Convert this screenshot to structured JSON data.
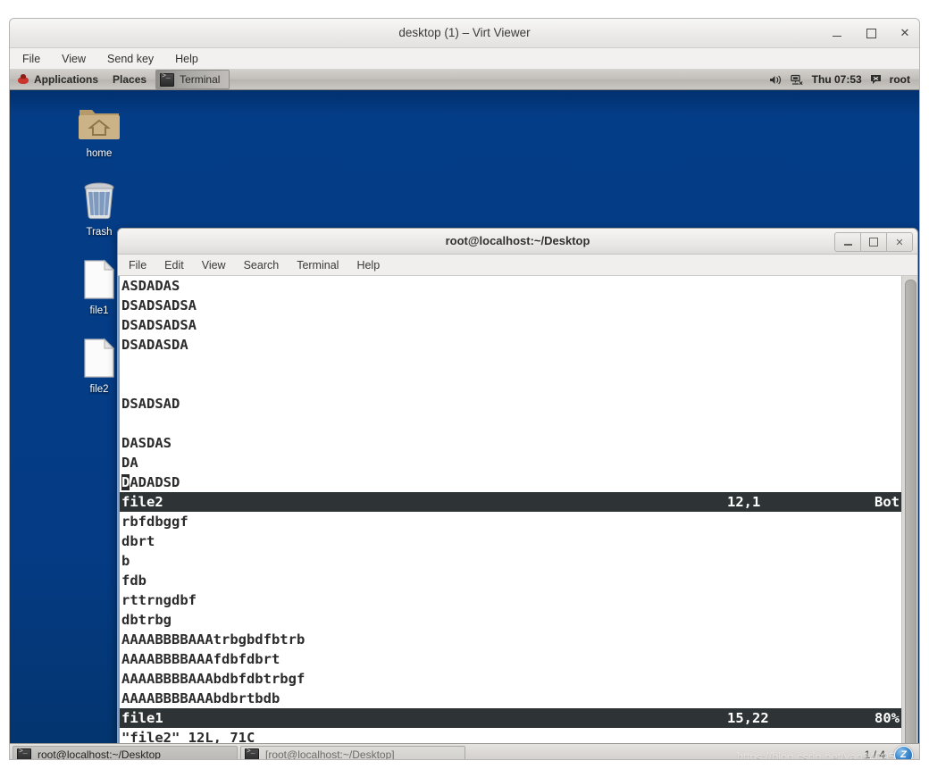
{
  "viewer": {
    "title": "desktop (1) – Virt Viewer",
    "menu": [
      "File",
      "View",
      "Send key",
      "Help"
    ],
    "buttons": {
      "minimize": "–",
      "maximize": "□",
      "close": "✕"
    }
  },
  "panel": {
    "applications": "Applications",
    "places": "Places",
    "window_button": "Terminal",
    "clock": "Thu 07:53",
    "user": "root",
    "icons": {
      "logo": "redhat-logo-icon",
      "terminal": "terminal-icon",
      "volume": "volume-icon",
      "network": "network-disconnected-icon",
      "messaging": "messaging-icon"
    }
  },
  "desktop": {
    "background_color": "#043b84",
    "icons": [
      {
        "label": "home",
        "icon": "home-folder-icon"
      },
      {
        "label": "Trash",
        "icon": "trash-icon"
      },
      {
        "label": "file1",
        "icon": "text-file-icon"
      },
      {
        "label": "file2",
        "icon": "text-file-icon"
      }
    ]
  },
  "terminal": {
    "title": "root@localhost:~/Desktop",
    "menu": [
      "File",
      "Edit",
      "View",
      "Search",
      "Terminal",
      "Help"
    ],
    "window_buttons": {
      "minimize": "–",
      "maximize": "□",
      "close": "✕"
    },
    "colors": {
      "status_bg": "#2e3436",
      "status_fg": "#ffffff",
      "text_fg": "#2b2b2b",
      "bg": "#ffffff"
    },
    "lines": [
      {
        "type": "text",
        "text": "ASDADAS"
      },
      {
        "type": "text",
        "text": "DSADSADSA"
      },
      {
        "type": "text",
        "text": "DSADSADSA"
      },
      {
        "type": "text",
        "text": "DSADASDA"
      },
      {
        "type": "text",
        "text": ""
      },
      {
        "type": "text",
        "text": ""
      },
      {
        "type": "text",
        "text": "DSADSAD"
      },
      {
        "type": "text",
        "text": ""
      },
      {
        "type": "text",
        "text": "DASDAS"
      },
      {
        "type": "text",
        "text": "DA"
      },
      {
        "type": "cursor",
        "cursor_char": "D",
        "rest": "ADADSD"
      },
      {
        "type": "status",
        "name": "file2",
        "position": "12,1",
        "percent": "Bot"
      },
      {
        "type": "text",
        "text": "rbfdbggf"
      },
      {
        "type": "text",
        "text": "dbrt"
      },
      {
        "type": "text",
        "text": "b"
      },
      {
        "type": "text",
        "text": "fdb"
      },
      {
        "type": "text",
        "text": "rttrngdbf"
      },
      {
        "type": "text",
        "text": "dbtrbg"
      },
      {
        "type": "text",
        "text": "AAAABBBBAAAtrbgbdfbtrb"
      },
      {
        "type": "text",
        "text": "AAAABBBBAAAfdbfdbrt"
      },
      {
        "type": "text",
        "text": "AAAABBBBAAAbdbfdbtrbgf"
      },
      {
        "type": "text",
        "text": "AAAABBBBAAAbdbrtbdb"
      },
      {
        "type": "status",
        "name": "file1",
        "position": "15,22",
        "percent": "80%"
      },
      {
        "type": "text",
        "text": "\"file2\" 12L, 71C"
      }
    ]
  },
  "taskbar": {
    "items": [
      {
        "label": "root@localhost:~/Desktop",
        "state": "active",
        "icon": "terminal-icon"
      },
      {
        "label": "[root@localhost:~/Desktop]",
        "state": "inactive",
        "icon": "terminal-icon"
      }
    ],
    "workspace": "1 / 4",
    "workspace_badge": "Z",
    "watermark": "https://blog.csdn.net/yan94095"
  }
}
